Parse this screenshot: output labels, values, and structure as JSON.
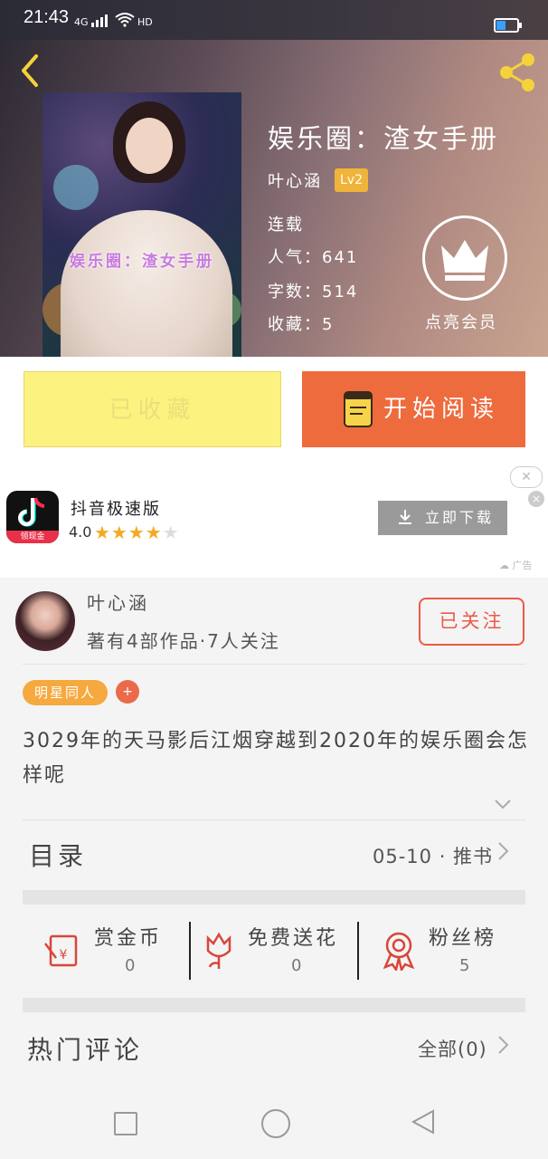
{
  "status_bar": {
    "time": "21:43",
    "signal": "4G",
    "network": "HD"
  },
  "book": {
    "title": "娱乐圈：渣女手册",
    "cover_text": "娱乐圈：渣女手册",
    "author": "叶心涵",
    "level": "Lv2",
    "status": "连载",
    "popularity": "人气：641",
    "word_count": "字数：514",
    "favorites": "收藏：5",
    "vip_label": "点亮会员"
  },
  "actions": {
    "favorited_label": "已收藏",
    "read_label": "开始阅读"
  },
  "ad": {
    "app_name": "抖音极速版",
    "icon_tag": "领现金",
    "rating": "4.0",
    "stars": "★★★★",
    "star_off": "★",
    "download_label": "立即下载",
    "close_label": "✕",
    "ad_tag": "广告"
  },
  "author_row": {
    "name": "叶心涵",
    "summary": "著有4部作品·7人关注",
    "follow_label": "已关注"
  },
  "tags": {
    "primary": "明星同人",
    "add": "+"
  },
  "intro": "3029年的天马影后江烟穿越到2020年的娱乐圈会怎样呢",
  "toc": {
    "label": "目录",
    "latest": "05-10 · 推书"
  },
  "stats": [
    {
      "label": "赏金币",
      "value": "0"
    },
    {
      "label": "免费送花",
      "value": "0"
    },
    {
      "label": "粉丝榜",
      "value": "5"
    }
  ],
  "comments": {
    "label": "热门评论",
    "all": "全部(0)"
  },
  "colors": {
    "accent": "#ee6b3d",
    "follow": "#ea5a48",
    "tag": "#f5a93e",
    "favorite_bg": "#fbf280"
  }
}
